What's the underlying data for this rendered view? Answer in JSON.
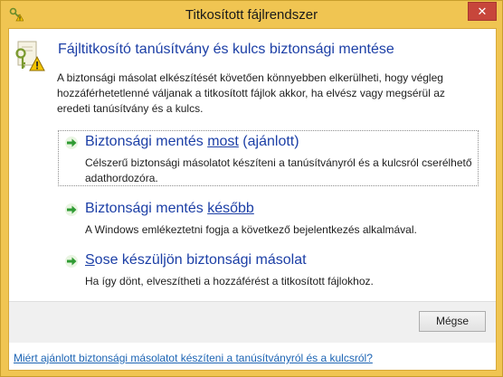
{
  "window": {
    "title": "Titkosított fájlrendszer",
    "close_symbol": "✕",
    "title_icon": "certificate-key-warning-icon"
  },
  "header": {
    "icon": "certificate-key-warning-icon",
    "heading": "Fájltitkosító tanúsítvány és kulcs biztonsági mentése"
  },
  "description": "A biztonsági másolat elkészítését követően könnyebben elkerülheti, hogy végleg hozzáférhetetlenné váljanak a titkosított fájlok akkor, ha elvész vagy megsérül az eredeti tanúsítvány és a kulcs.",
  "options": [
    {
      "title_before": "Biztonsági mentés ",
      "title_underlined": "most",
      "title_after": " (ajánlott)",
      "description": "Célszerű biztonsági másolatot készíteni a tanúsítványról és a kulcsról cserélhető adathordozóra.",
      "icon": "green-arrow-icon"
    },
    {
      "title_before": "Biztonsági mentés ",
      "title_underlined": "később",
      "title_after": "",
      "description": "A Windows emlékeztetni fogja a következő bejelentkezés alkalmával.",
      "icon": "green-arrow-icon"
    },
    {
      "title_before": "",
      "title_underlined": "S",
      "title_after": "ose készüljön biztonsági másolat",
      "description": "Ha így dönt, elveszítheti a hozzáférést a titkosított fájlokhoz.",
      "icon": "green-arrow-icon"
    }
  ],
  "buttons": {
    "cancel_label": "Mégse"
  },
  "footer": {
    "link_text": "Miért ajánlott biztonsági másolatot készíteni a tanúsítványról és a kulcsról?"
  },
  "colors": {
    "frame": "#f0c552",
    "heading": "#1c3fa6",
    "link": "#1c64b4",
    "close_button": "#c7463b"
  }
}
